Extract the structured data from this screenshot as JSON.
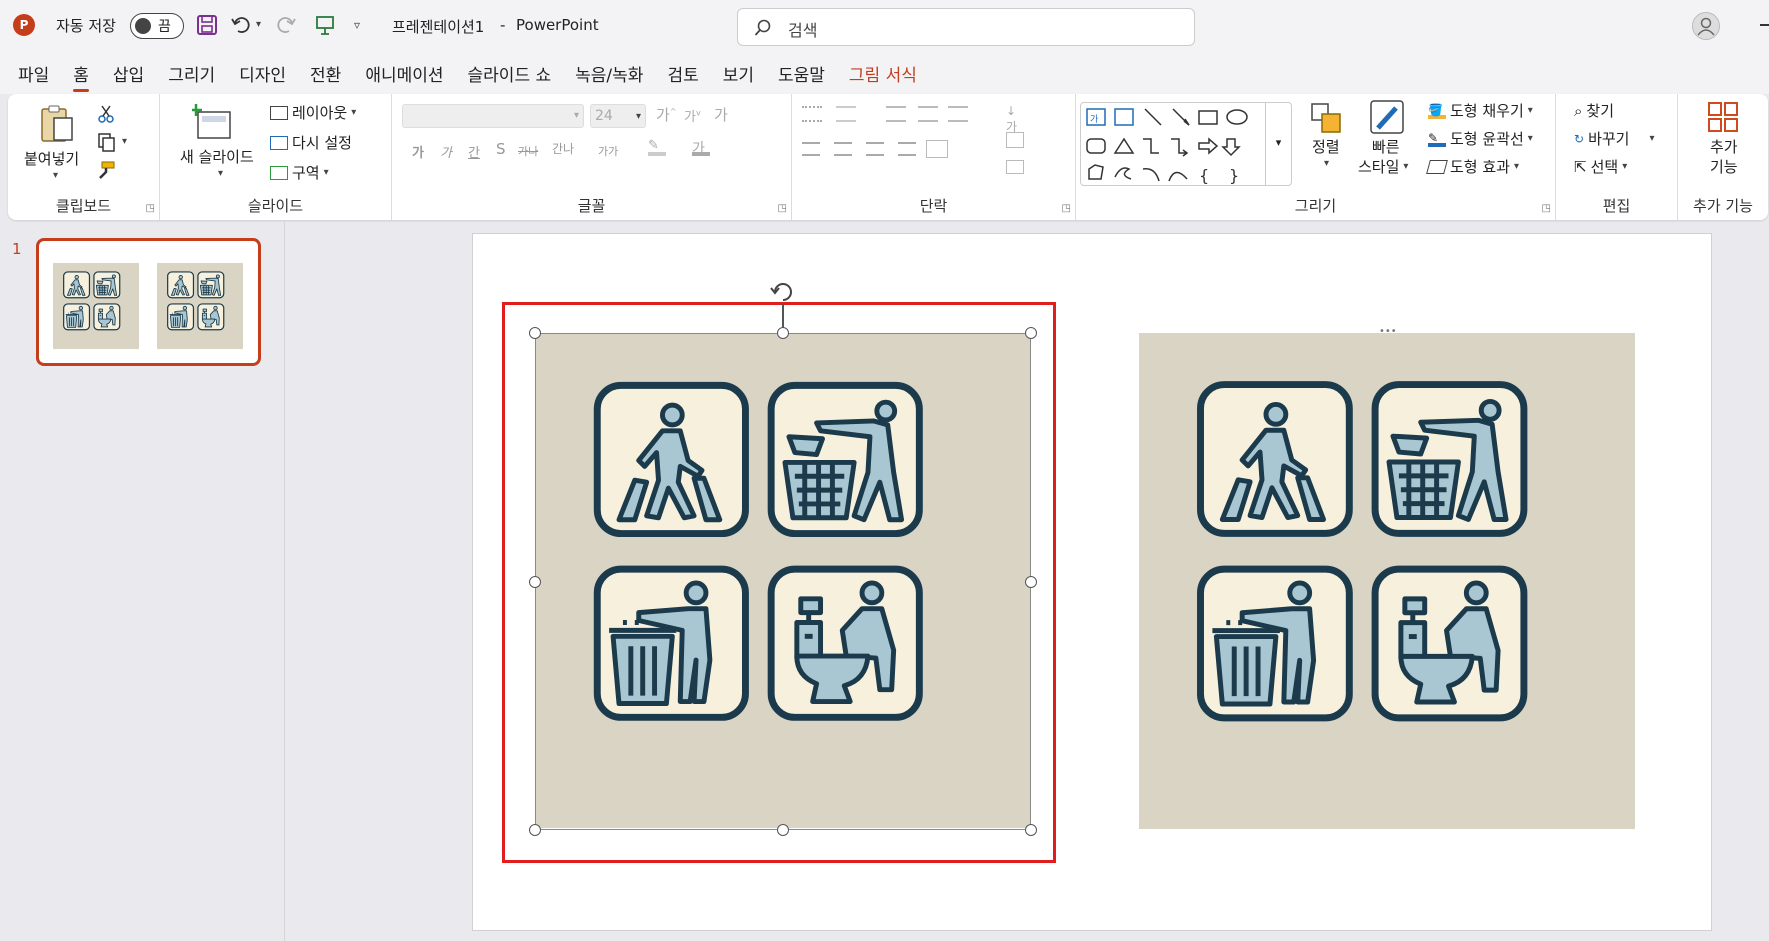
{
  "titlebar": {
    "autosave_label": "자동 저장",
    "autosave_state": "끔",
    "doc_title": "프레젠테이션1",
    "separator": "-",
    "app_name": "PowerPoint",
    "search_placeholder": "검색"
  },
  "menu": {
    "tabs": [
      "파일",
      "홈",
      "삽입",
      "그리기",
      "디자인",
      "전환",
      "애니메이션",
      "슬라이드 쇼",
      "녹음/녹화",
      "검토",
      "보기",
      "도움말",
      "그림 서식"
    ],
    "active_index": 1,
    "contextual_color": "#c43e1c"
  },
  "ribbon": {
    "clipboard": {
      "paste": "붙여넣기",
      "label": "클립보드"
    },
    "slides": {
      "new_slide": "새 슬라이드",
      "layout": "레이아웃",
      "reset": "다시 설정",
      "section": "구역",
      "label": "슬라이드"
    },
    "font": {
      "font_size": "24",
      "bold": "가",
      "italic": "가",
      "underline": "간",
      "shadow": "S",
      "strike": "가나",
      "spacing": "간나",
      "case": "가가",
      "label": "글꼴"
    },
    "paragraph": {
      "label": "단락"
    },
    "drawing": {
      "arrange": "정렬",
      "quick_styles_1": "빠른",
      "quick_styles_2": "스타일",
      "fill": "도형 채우기",
      "outline": "도형 윤곽선",
      "effects": "도형 효과",
      "label": "그리기",
      "textbox_glyph": "가"
    },
    "editing": {
      "find": "찾기",
      "replace": "바꾸기",
      "select": "선택",
      "label": "편집"
    },
    "addins": {
      "label1": "추가",
      "label2": "기능",
      "group_label": "추가 기능"
    }
  },
  "thumbs": {
    "slide_number": "1"
  },
  "colors": {
    "accent": "#c43e1c",
    "selection_red": "#e11d1d",
    "icon_dark": "#1b3a4b",
    "icon_fill": "#a9c7d2",
    "tile_bg": "#f7f0dc",
    "image_bg": "#d9d4c4"
  }
}
